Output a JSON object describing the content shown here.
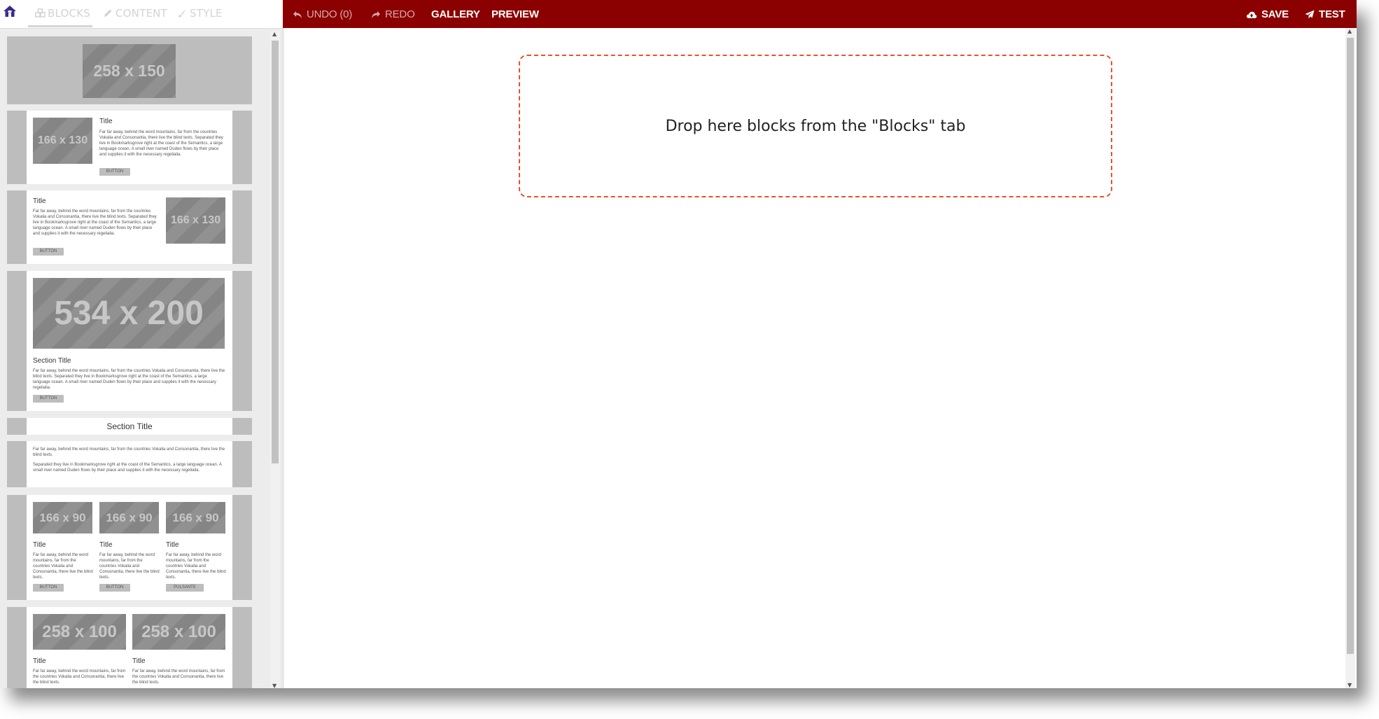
{
  "sidebar": {
    "tabs": [
      {
        "label": "BLOCKS",
        "icon": "blocks-icon"
      },
      {
        "label": "CONTENT",
        "icon": "pencil-icon"
      },
      {
        "label": "STYLE",
        "icon": "brush-icon"
      }
    ],
    "home_icon": "home-icon"
  },
  "blocks": {
    "b1": {
      "image": "258 x 150"
    },
    "b2": {
      "image": "166 x 130",
      "title": "Title",
      "text": "Far far away, behind the word mountains, far from the countries Vokalia and Consonantia, there live the blind texts. Separated they live in Bookmarksgrove right at the coast of the Semantics, a large language ocean. A small river named Duden flows by their place and supplies it with the necessary regelialia.",
      "button": "BUTTON"
    },
    "b3": {
      "image": "166 x 130",
      "title": "Title",
      "text": "Far far away, behind the word mountains, far from the countries Vokalia and Consonantia, there live the blind texts. Separated they live in Bookmarksgrove right at the coast of the Semantics, a large language ocean. A small river named Duden flows by their place and supplies it with the necessary regelialia.",
      "button": "BUTTON"
    },
    "b4": {
      "image": "534 x 200",
      "title": "Section Title",
      "text": "Far far away, behind the word mountains, far from the countries Vokalia and Consonantia, there live the blind texts. Separated they live in Bookmarksgrove right at the coast of the Semantics, a large language ocean. A small river named Duden flows by their place and supplies it with the necessary regelialia.",
      "button": "BUTTON"
    },
    "b5": {
      "title": "Section Title"
    },
    "b6": {
      "text1": "Far far away, behind the word mountains, far from the countries Vokalia and Consonantia, there live the blind texts.",
      "text2": "Separated they live in Bookmarksgrove right at the coast of the Semantics, a large language ocean. A small river named Duden flows by their place and supplies it with the necessary regelialia."
    },
    "b7": {
      "cols": [
        {
          "image": "166 x 90",
          "title": "Title",
          "text": "Far far away, behind the word mountains, far from the countries Vokalia and Consonantia, there live the blind texts.",
          "button": "BUTTON"
        },
        {
          "image": "166 x 90",
          "title": "Title",
          "text": "Far far away, behind the word mountains, far from the countries Vokalia and Consonantia, there live the blind texts.",
          "button": "BUTTON"
        },
        {
          "image": "166 x 90",
          "title": "Title",
          "text": "Far far away, behind the word mountains, far from the countries Vokalia and Consonantia, there live the blind texts.",
          "button": "PULSANTE"
        }
      ]
    },
    "b8": {
      "cols": [
        {
          "image": "258 x 100",
          "title": "Title",
          "text": "Far far away, behind the word mountains, far from the countries Vokalia and Consonantia, there live the blind texts."
        },
        {
          "image": "258 x 100",
          "title": "Title",
          "text": "Far far away, behind the word mountains, far from the countries Vokalia and Consonantia, there live the blind texts."
        }
      ]
    }
  },
  "toolbar": {
    "undo_label": "UNDO (0)",
    "redo_label": "REDO",
    "gallery_label": "GALLERY",
    "preview_label": "PREVIEW",
    "save_label": "SAVE",
    "test_label": "TEST"
  },
  "canvas": {
    "drop_text": "Drop here blocks from the \"Blocks\" tab"
  },
  "colors": {
    "topbar": "#8b0000",
    "dropzone_border": "#e8512c",
    "home_icon": "#3b2a8c"
  }
}
